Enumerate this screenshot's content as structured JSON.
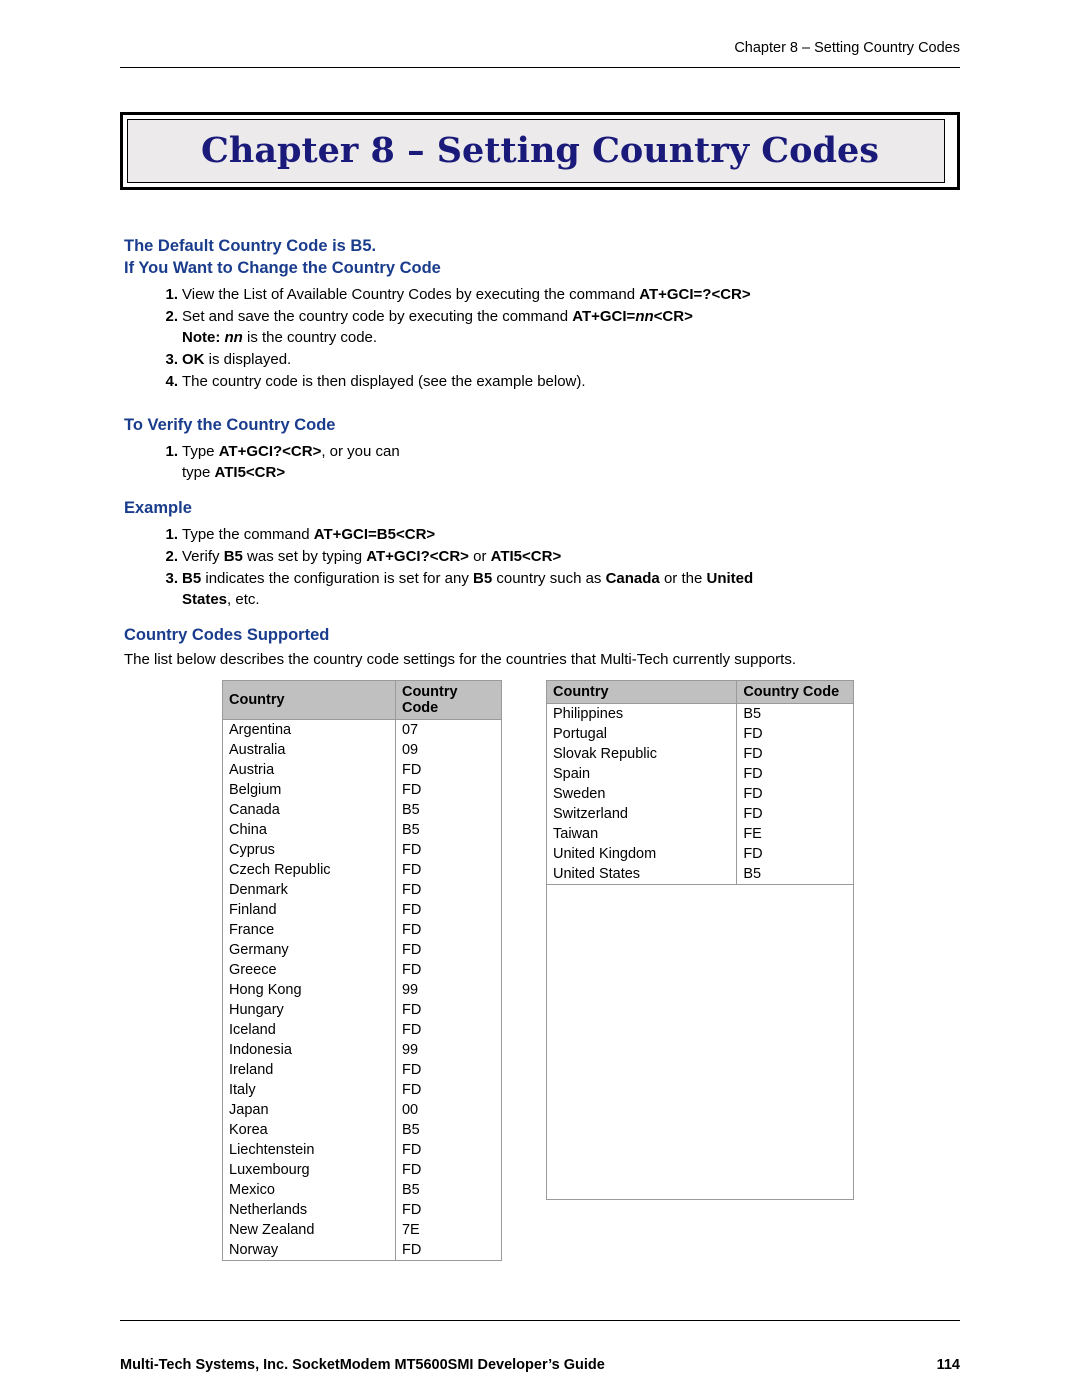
{
  "header": {
    "running_head": "Chapter 8 – Setting Country Codes"
  },
  "chapter": {
    "title": "Chapter 8 – Setting Country Codes"
  },
  "sections": {
    "default_code_heading": "The Default Country Code is B5.",
    "change_code_heading": "If You Want to Change the Country Code",
    "change_steps": [
      {
        "num": "1.",
        "parts": [
          {
            "t": "View the List of Available Country Codes by executing the command ",
            "s": "n"
          },
          {
            "t": "AT+GCI=?<CR>",
            "s": "b"
          }
        ]
      },
      {
        "num": "2.",
        "parts": [
          {
            "t": "Set and save the country code by executing the command ",
            "s": "n"
          },
          {
            "t": "AT+GCI=",
            "s": "b"
          },
          {
            "t": "nn",
            "s": "bi"
          },
          {
            "t": "<CR>",
            "s": "b"
          },
          {
            "t": "\n",
            "s": "br"
          },
          {
            "t": "Note:",
            "s": "b"
          },
          {
            "t": " ",
            "s": "n"
          },
          {
            "t": "nn",
            "s": "bi"
          },
          {
            "t": " is the country code.",
            "s": "n"
          }
        ]
      },
      {
        "num": "3.",
        "parts": [
          {
            "t": "OK",
            "s": "b"
          },
          {
            "t": " is displayed.",
            "s": "n"
          }
        ]
      },
      {
        "num": "4.",
        "parts": [
          {
            "t": "The country code is then displayed (see the example below).",
            "s": "n"
          }
        ]
      }
    ],
    "verify_heading": "To Verify the Country Code",
    "verify_steps": [
      {
        "num": "1.",
        "parts": [
          {
            "t": "Type ",
            "s": "n"
          },
          {
            "t": "AT+GCI?<CR>",
            "s": "b"
          },
          {
            "t": ", or you can",
            "s": "n"
          },
          {
            "t": "\n",
            "s": "br"
          },
          {
            "t": "type ",
            "s": "n"
          },
          {
            "t": "ATI5<CR>",
            "s": "b"
          }
        ]
      }
    ],
    "example_heading": "Example",
    "example_steps": [
      {
        "num": "1.",
        "parts": [
          {
            "t": "Type the command ",
            "s": "n"
          },
          {
            "t": "AT+GCI=B5<CR>",
            "s": "b"
          }
        ]
      },
      {
        "num": "2.",
        "parts": [
          {
            "t": "Verify ",
            "s": "n"
          },
          {
            "t": "B5",
            "s": "b"
          },
          {
            "t": " was set by typing ",
            "s": "n"
          },
          {
            "t": "AT+GCI?<CR>",
            "s": "b"
          },
          {
            "t": " or  ",
            "s": "n"
          },
          {
            "t": "ATI5<CR>",
            "s": "b"
          }
        ]
      },
      {
        "num": "3.",
        "parts": [
          {
            "t": "B5",
            "s": "b"
          },
          {
            "t": " indicates the configuration is set for any ",
            "s": "n"
          },
          {
            "t": "B5",
            "s": "b"
          },
          {
            "t": " country such as ",
            "s": "n"
          },
          {
            "t": "Canada",
            "s": "b"
          },
          {
            "t": " or the ",
            "s": "n"
          },
          {
            "t": "United",
            "s": "b"
          },
          {
            "t": "\n",
            "s": "br"
          },
          {
            "t": "States",
            "s": "b"
          },
          {
            "t": ", etc.",
            "s": "n"
          }
        ]
      }
    ],
    "supported_heading": "Country Codes Supported",
    "supported_intro": "The list below describes the country code settings for the countries that Multi-Tech currently supports."
  },
  "table": {
    "columns": [
      "Country",
      "Country Code"
    ],
    "left_rows": [
      [
        "Argentina",
        "07"
      ],
      [
        "Australia",
        "09"
      ],
      [
        "Austria",
        "FD"
      ],
      [
        "Belgium",
        "FD"
      ],
      [
        "Canada",
        "B5"
      ],
      [
        "China",
        "B5"
      ],
      [
        "Cyprus",
        "FD"
      ],
      [
        "Czech Republic",
        "FD"
      ],
      [
        "Denmark",
        "FD"
      ],
      [
        "Finland",
        "FD"
      ],
      [
        "France",
        "FD"
      ],
      [
        "Germany",
        "FD"
      ],
      [
        "Greece",
        "FD"
      ],
      [
        "Hong Kong",
        "99"
      ],
      [
        "Hungary",
        "FD"
      ],
      [
        "Iceland",
        "FD"
      ],
      [
        "Indonesia",
        "99"
      ],
      [
        "Ireland",
        "FD"
      ],
      [
        "Italy",
        "FD"
      ],
      [
        "Japan",
        "00"
      ],
      [
        "Korea",
        "B5"
      ],
      [
        "Liechtenstein",
        "FD"
      ],
      [
        "Luxembourg",
        "FD"
      ],
      [
        "Mexico",
        "B5"
      ],
      [
        "Netherlands",
        "FD"
      ],
      [
        "New Zealand",
        "7E"
      ],
      [
        "Norway",
        "FD"
      ]
    ],
    "right_rows": [
      [
        "Philippines",
        "B5"
      ],
      [
        "Portugal",
        "FD"
      ],
      [
        "Slovak Republic",
        "FD"
      ],
      [
        "Spain",
        "FD"
      ],
      [
        "Sweden",
        "FD"
      ],
      [
        "Switzerland",
        "FD"
      ],
      [
        "Taiwan",
        "FE"
      ],
      [
        "United Kingdom",
        "FD"
      ],
      [
        "United States",
        "B5"
      ]
    ]
  },
  "footer": {
    "left": "Multi-Tech Systems, Inc. SocketModem MT5600SMI Developer’s Guide",
    "page_number": "114"
  }
}
